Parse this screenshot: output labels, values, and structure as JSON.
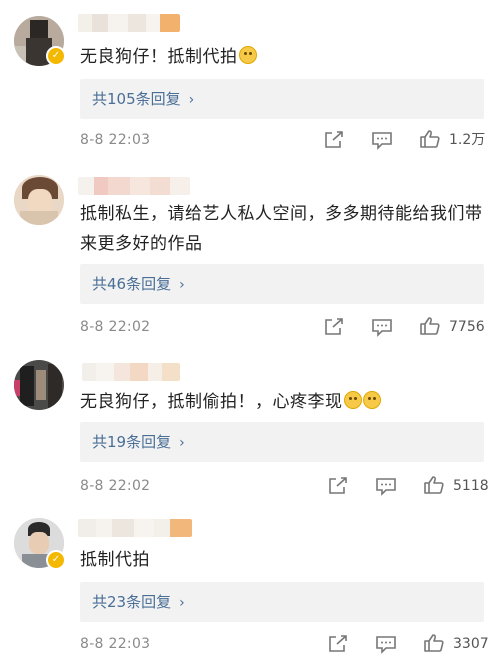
{
  "comments": [
    {
      "text": "无良狗仔！抵制代拍",
      "reply_label": "共105条回复",
      "time": "8-8 22:03",
      "likes": "1.2万",
      "verified": true
    },
    {
      "text": "抵制私生，请给艺人私人空间，多多期待能给我们带来更多好的作品",
      "reply_label": "共46条回复",
      "time": "8-8 22:02",
      "likes": "7756",
      "verified": false
    },
    {
      "text": "无良狗仔，抵制偷拍！，心疼李现",
      "reply_label": "共19条回复",
      "time": "8-8 22:02",
      "likes": "5118",
      "verified": false
    },
    {
      "text": "抵制代拍",
      "reply_label": "共23条回复",
      "time": "8-8 22:03",
      "likes": "3307",
      "verified": true
    }
  ],
  "icons": {
    "share": "share-icon",
    "comment": "comment-icon",
    "like": "thumbs-up-icon",
    "chevron": "chevron-right-icon"
  },
  "colors": {
    "reply_link": "#4a6e96",
    "reply_bg": "#f2f2f2",
    "meta_text": "#8a8a8a",
    "verified_badge": "#f5b800"
  }
}
